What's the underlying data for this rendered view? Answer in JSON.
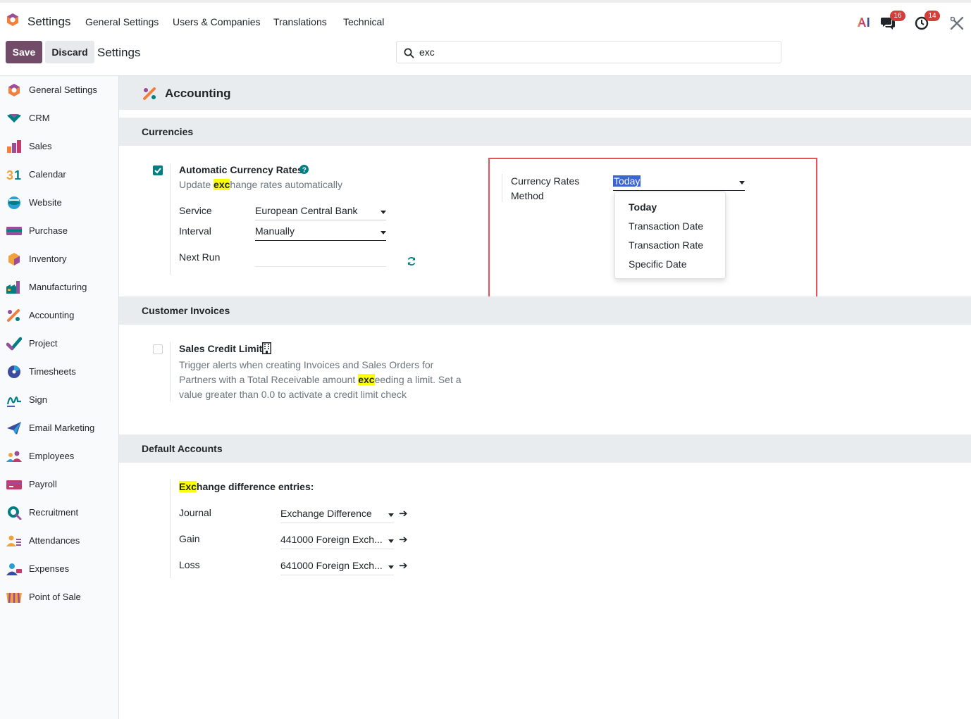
{
  "topbar": {
    "brand": "Settings",
    "menu": [
      "General Settings",
      "Users & Companies",
      "Translations",
      "Technical"
    ],
    "messages_count": "16",
    "activities_count": "14"
  },
  "control": {
    "save_label": "Save",
    "discard_label": "Discard",
    "breadcrumb": "Settings",
    "search_value": "exc"
  },
  "sidebar": {
    "items": [
      {
        "label": "General Settings",
        "icon": "general-settings-icon"
      },
      {
        "label": "CRM",
        "icon": "crm-icon"
      },
      {
        "label": "Sales",
        "icon": "sales-icon"
      },
      {
        "label": "Calendar",
        "icon": "calendar-icon"
      },
      {
        "label": "Website",
        "icon": "website-icon"
      },
      {
        "label": "Purchase",
        "icon": "purchase-icon"
      },
      {
        "label": "Inventory",
        "icon": "inventory-icon"
      },
      {
        "label": "Manufacturing",
        "icon": "manufacturing-icon"
      },
      {
        "label": "Accounting",
        "icon": "accounting-icon"
      },
      {
        "label": "Project",
        "icon": "project-icon"
      },
      {
        "label": "Timesheets",
        "icon": "timesheets-icon"
      },
      {
        "label": "Sign",
        "icon": "sign-icon"
      },
      {
        "label": "Email Marketing",
        "icon": "email-marketing-icon"
      },
      {
        "label": "Employees",
        "icon": "employees-icon"
      },
      {
        "label": "Payroll",
        "icon": "payroll-icon"
      },
      {
        "label": "Recruitment",
        "icon": "recruitment-icon"
      },
      {
        "label": "Attendances",
        "icon": "attendances-icon"
      },
      {
        "label": "Expenses",
        "icon": "expenses-icon"
      },
      {
        "label": "Point of Sale",
        "icon": "point-of-sale-icon"
      }
    ]
  },
  "accounting": {
    "title": "Accounting",
    "currencies": {
      "section_title": "Currencies",
      "auto_rates": {
        "title": "Automatic Currency Rates",
        "checked": true,
        "desc_pre": "Update ",
        "desc_hl": "exc",
        "desc_post": "hange rates automatically",
        "service_label": "Service",
        "service_value": "European Central Bank",
        "interval_label": "Interval",
        "interval_value": "Manually",
        "next_run_label": "Next Run",
        "next_run_value": ""
      },
      "rates_method": {
        "label_line1": "Currency Rates",
        "label_line2": "Method",
        "value": "Today",
        "options": [
          "Today",
          "Transaction Date",
          "Transaction Rate",
          "Specific Date"
        ]
      }
    },
    "customer_invoices": {
      "section_title": "Customer Invoices",
      "credit_limit": {
        "title": "Sales Credit Limit",
        "checked": false,
        "desc_line1": "Trigger alerts when creating Invoices and Sales Orders for",
        "desc_line2_pre": "Partners with a Total Receivable amount ",
        "desc_line2_hl": "exc",
        "desc_line2_post": "eeding a limit. Set a",
        "desc_line3": "value greater than 0.0 to activate a credit limit check"
      }
    },
    "default_accounts": {
      "section_title": "Default Accounts",
      "heading_hl": "Exc",
      "heading_rest": "hange difference entries:",
      "journal_label": "Journal",
      "journal_value": "Exchange Difference",
      "gain_label": "Gain",
      "gain_value": "441000 Foreign Exch...",
      "loss_label": "Loss",
      "loss_value": "641000 Foreign Exch..."
    }
  },
  "colors": {
    "brand": "#714b67",
    "teal": "#017e84",
    "highlight": "#fbff00",
    "badge": "#d23f3a",
    "selection": "#3b67d3",
    "annotation": "#e8505b"
  }
}
